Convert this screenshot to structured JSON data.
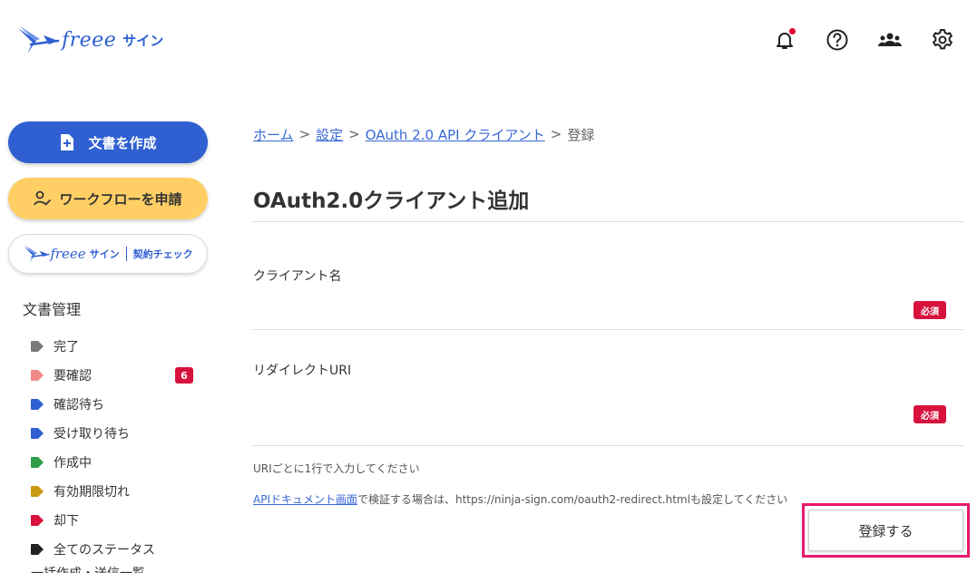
{
  "header": {
    "logo_text": "freee",
    "logo_sub": "サイン",
    "icons": [
      "bell-icon",
      "help-icon",
      "users-icon",
      "settings-icon"
    ]
  },
  "sidebar": {
    "create_doc_label": "文書を作成",
    "workflow_label": "ワークフローを申請",
    "contract_check": {
      "logo_text": "freee",
      "logo_sub": "サイン",
      "label": "契約チェック"
    },
    "section_title": "文書管理",
    "statuses": [
      {
        "label": "完了",
        "color": "#7a7a7a"
      },
      {
        "label": "要確認",
        "color": "#f08a8a",
        "count": "6"
      },
      {
        "label": "確認待ち",
        "color": "#2f5fd1"
      },
      {
        "label": "受け取り待ち",
        "color": "#2f5fd1"
      },
      {
        "label": "作成中",
        "color": "#2e9e48"
      },
      {
        "label": "有効期限切れ",
        "color": "#c99a10"
      },
      {
        "label": "却下",
        "color": "#d7123c"
      },
      {
        "label": "全てのステータス",
        "color": "#222222"
      }
    ],
    "more_label": "一括作成・送信一覧"
  },
  "breadcrumb": {
    "home": "ホーム",
    "settings": "設定",
    "oauth": "OAuth 2.0 API クライアント",
    "current": "登録",
    "separator": ">"
  },
  "page_title": "OAuth2.0クライアント追加",
  "form": {
    "client_name": {
      "label": "クライアント名",
      "required": "必須",
      "value": ""
    },
    "redirect_uri": {
      "label": "リダイレクトURI",
      "required": "必須",
      "value": ""
    },
    "note_line": "URIごとに1行で入力してください",
    "api_doc_link": "APIドキュメント画面",
    "api_doc_note": "で検証する場合は、https://ninja-sign.com/oauth2-redirect.htmlも設定してください",
    "submit_label": "登録する"
  },
  "colors": {
    "accent": "#2f5fd1",
    "workflow": "#ffcf66",
    "required": "#d7123c",
    "highlight": "#e8196b"
  }
}
